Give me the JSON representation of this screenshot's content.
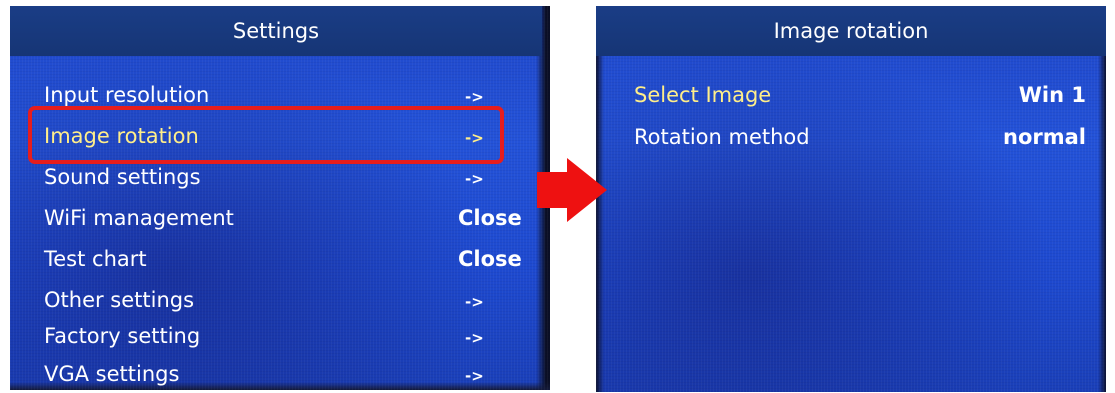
{
  "left_screen": {
    "title": "Settings",
    "items": [
      {
        "label": "Input resolution",
        "value": "->"
      },
      {
        "label": "Image rotation",
        "value": "->"
      },
      {
        "label": "Sound settings",
        "value": "->"
      },
      {
        "label": "WiFi management",
        "value": "Close"
      },
      {
        "label": "Test chart",
        "value": "Close"
      },
      {
        "label": "Other settings",
        "value": "->"
      },
      {
        "label": "Factory setting",
        "value": "->"
      },
      {
        "label": "VGA settings",
        "value": "->"
      }
    ]
  },
  "right_screen": {
    "title": "Image rotation",
    "items": [
      {
        "label": "Select Image",
        "value": "Win 1"
      },
      {
        "label": "Rotation method",
        "value": "normal"
      }
    ]
  },
  "colors": {
    "screen_blue": "#2352d8",
    "header_blue": "#1a3d86",
    "highlight_yellow": "#ffee8a",
    "callout_red": "#e61d1d"
  },
  "icons": {
    "transition_arrow": "right-arrow-icon"
  }
}
